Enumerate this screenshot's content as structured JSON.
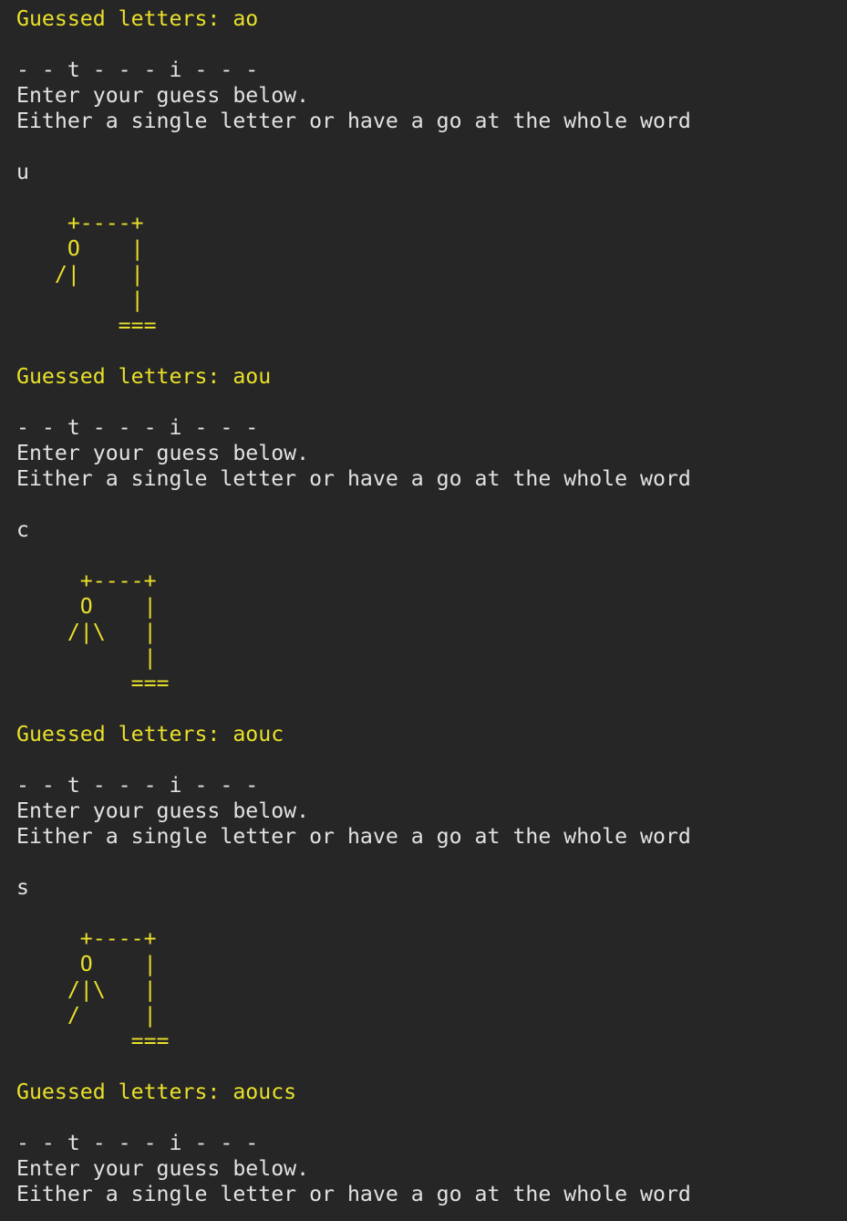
{
  "terminal": {
    "lines": [
      {
        "text": "Guessed letters: ao",
        "color": "#e9e02a"
      },
      {
        "text": "",
        "color": "#e2e2e2"
      },
      {
        "text": "- - t - - - i - - -",
        "color": "#e2e2e2"
      },
      {
        "text": "Enter your guess below.",
        "color": "#e2e2e2"
      },
      {
        "text": "Either a single letter or have a go at the whole word",
        "color": "#e2e2e2"
      },
      {
        "text": "",
        "color": "#e2e2e2"
      },
      {
        "text": "u",
        "color": "#e2e2e2"
      },
      {
        "text": "",
        "color": "#e2e2e2"
      },
      {
        "text": "    +----+",
        "color": "#e9e02a"
      },
      {
        "text": "    O    |",
        "color": "#e9e02a"
      },
      {
        "text": "   /|    |",
        "color": "#e9e02a"
      },
      {
        "text": "         |",
        "color": "#e9e02a"
      },
      {
        "text": "        ===",
        "color": "#e9e02a"
      },
      {
        "text": "",
        "color": "#e2e2e2"
      },
      {
        "text": "Guessed letters: aou",
        "color": "#e9e02a"
      },
      {
        "text": "",
        "color": "#e2e2e2"
      },
      {
        "text": "- - t - - - i - - -",
        "color": "#e2e2e2"
      },
      {
        "text": "Enter your guess below.",
        "color": "#e2e2e2"
      },
      {
        "text": "Either a single letter or have a go at the whole word",
        "color": "#e2e2e2"
      },
      {
        "text": "",
        "color": "#e2e2e2"
      },
      {
        "text": "c",
        "color": "#e2e2e2"
      },
      {
        "text": "",
        "color": "#e2e2e2"
      },
      {
        "text": "     +----+",
        "color": "#e9e02a"
      },
      {
        "text": "     O    |",
        "color": "#e9e02a"
      },
      {
        "text": "    /|\\   |",
        "color": "#e9e02a"
      },
      {
        "text": "          |",
        "color": "#e9e02a"
      },
      {
        "text": "         ===",
        "color": "#e9e02a"
      },
      {
        "text": "",
        "color": "#e2e2e2"
      },
      {
        "text": "Guessed letters: aouc",
        "color": "#e9e02a"
      },
      {
        "text": "",
        "color": "#e2e2e2"
      },
      {
        "text": "- - t - - - i - - -",
        "color": "#e2e2e2"
      },
      {
        "text": "Enter your guess below.",
        "color": "#e2e2e2"
      },
      {
        "text": "Either a single letter or have a go at the whole word",
        "color": "#e2e2e2"
      },
      {
        "text": "",
        "color": "#e2e2e2"
      },
      {
        "text": "s",
        "color": "#e2e2e2"
      },
      {
        "text": "",
        "color": "#e2e2e2"
      },
      {
        "text": "     +----+",
        "color": "#e9e02a"
      },
      {
        "text": "     O    |",
        "color": "#e9e02a"
      },
      {
        "text": "    /|\\   |",
        "color": "#e9e02a"
      },
      {
        "text": "    /     |",
        "color": "#e9e02a"
      },
      {
        "text": "         ===",
        "color": "#e9e02a"
      },
      {
        "text": "",
        "color": "#e2e2e2"
      },
      {
        "text": "Guessed letters: aoucs",
        "color": "#e9e02a"
      },
      {
        "text": "",
        "color": "#e2e2e2"
      },
      {
        "text": "- - t - - - i - - -",
        "color": "#e2e2e2"
      },
      {
        "text": "Enter your guess below.",
        "color": "#e2e2e2"
      },
      {
        "text": "Either a single letter or have a go at the whole word",
        "color": "#e2e2e2"
      }
    ]
  }
}
